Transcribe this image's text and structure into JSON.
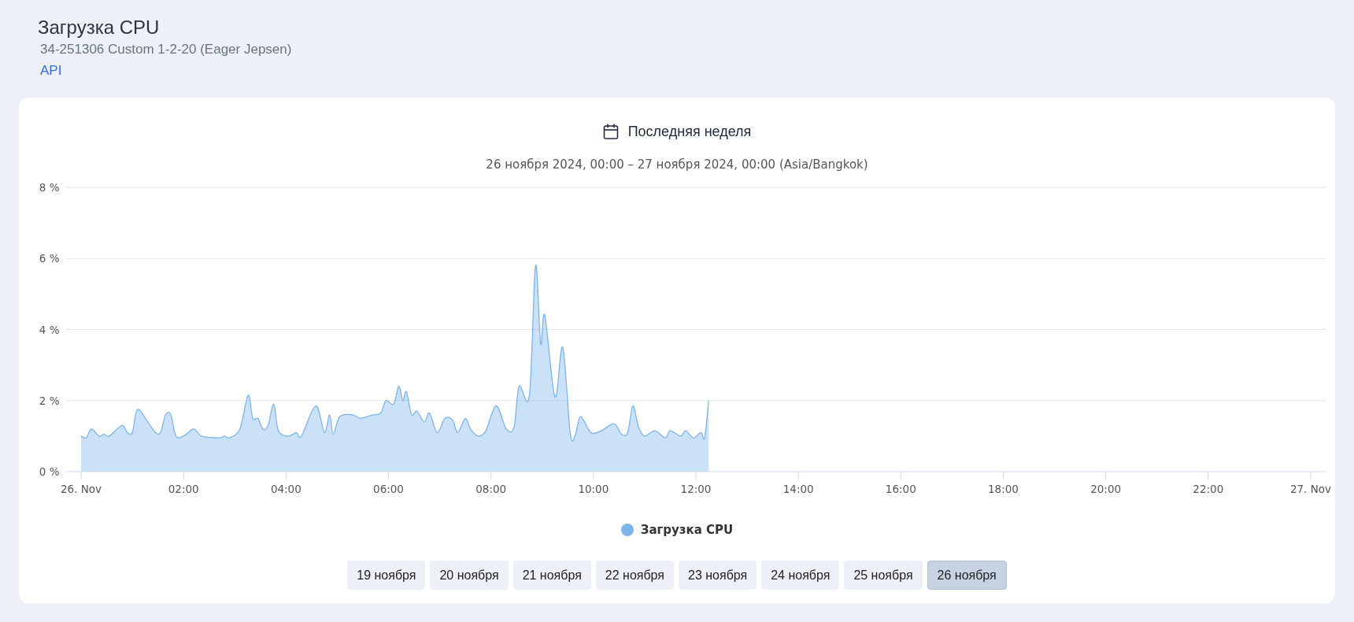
{
  "page": {
    "title": "Загрузка CPU",
    "subtitle": "34-251306 Custom 1-2-20 (Eager Jepsen)",
    "link": "API"
  },
  "card": {
    "period": "Последняя неделя",
    "range": "26 ноября 2024, 00:00 – 27 ноября 2024, 00:00 (Asia/Bangkok)",
    "chart_data": {
      "type": "area",
      "grid": true,
      "xlim": [
        -0.3,
        24.3
      ],
      "ylim": [
        0,
        8
      ],
      "xticks": [
        {
          "value": 0,
          "label": "26. Nov"
        },
        {
          "value": 2,
          "label": "02:00"
        },
        {
          "value": 4,
          "label": "04:00"
        },
        {
          "value": 6,
          "label": "06:00"
        },
        {
          "value": 8,
          "label": "08:00"
        },
        {
          "value": 10,
          "label": "10:00"
        },
        {
          "value": 12,
          "label": "12:00"
        },
        {
          "value": 14,
          "label": "14:00"
        },
        {
          "value": 16,
          "label": "16:00"
        },
        {
          "value": 18,
          "label": "18:00"
        },
        {
          "value": 20,
          "label": "20:00"
        },
        {
          "value": 22,
          "label": "22:00"
        },
        {
          "value": 24,
          "label": "27. Nov"
        }
      ],
      "yticks": [
        {
          "value": 0,
          "label": "0 %"
        },
        {
          "value": 2,
          "label": "2 %"
        },
        {
          "value": 4,
          "label": "4 %"
        },
        {
          "value": 6,
          "label": "6 %"
        },
        {
          "value": 8,
          "label": "8 %"
        }
      ],
      "x": [
        0,
        0.1,
        0.2,
        0.35,
        0.45,
        0.55,
        0.8,
        0.9,
        1.0,
        1.1,
        1.3,
        1.45,
        1.55,
        1.65,
        1.75,
        1.85,
        2.0,
        2.2,
        2.35,
        2.7,
        2.8,
        2.9,
        3.1,
        3.26,
        3.35,
        3.45,
        3.55,
        3.65,
        3.76,
        3.85,
        4.05,
        4.2,
        4.3,
        4.58,
        4.75,
        4.85,
        4.92,
        5.05,
        5.3,
        5.45,
        5.7,
        5.85,
        5.95,
        6.1,
        6.2,
        6.28,
        6.35,
        6.45,
        6.55,
        6.7,
        6.8,
        6.95,
        7.1,
        7.25,
        7.35,
        7.5,
        7.6,
        7.75,
        7.9,
        8.1,
        8.3,
        8.45,
        8.55,
        8.75,
        8.87,
        8.97,
        9.05,
        9.25,
        9.4,
        9.55,
        9.65,
        9.75,
        9.95,
        10.15,
        10.4,
        10.55,
        10.67,
        10.77,
        10.88,
        11.0,
        11.2,
        11.4,
        11.5,
        11.7,
        11.8,
        11.95,
        12.1,
        12.17,
        12.25
      ],
      "series": [
        {
          "name": "Загрузка CPU",
          "color": "#7cb5ec",
          "values": [
            1.0,
            0.95,
            1.2,
            1.0,
            1.05,
            1.0,
            1.3,
            1.1,
            1.1,
            1.75,
            1.4,
            1.1,
            1.1,
            1.6,
            1.6,
            1.0,
            1.0,
            1.2,
            1.0,
            0.95,
            1.0,
            0.95,
            1.2,
            2.15,
            1.5,
            1.5,
            1.2,
            1.3,
            1.9,
            1.15,
            1.0,
            1.1,
            1.0,
            1.85,
            1.1,
            1.6,
            1.05,
            1.55,
            1.6,
            1.5,
            1.6,
            1.65,
            2.0,
            1.9,
            2.4,
            2.0,
            2.25,
            1.6,
            1.7,
            1.4,
            1.65,
            1.1,
            1.5,
            1.45,
            1.1,
            1.5,
            1.2,
            1.0,
            1.15,
            1.85,
            1.2,
            1.25,
            2.4,
            2.15,
            5.8,
            3.6,
            4.4,
            2.1,
            3.5,
            1.05,
            1.05,
            1.55,
            1.1,
            1.15,
            1.35,
            1.05,
            1.1,
            1.85,
            1.25,
            1.0,
            1.15,
            0.95,
            1.15,
            1.0,
            1.15,
            0.95,
            1.1,
            0.95,
            2.0
          ]
        }
      ]
    },
    "days": [
      {
        "label": "19 ноября",
        "selected": false
      },
      {
        "label": "20 ноября",
        "selected": false
      },
      {
        "label": "21 ноября",
        "selected": false
      },
      {
        "label": "22 ноября",
        "selected": false
      },
      {
        "label": "23 ноября",
        "selected": false
      },
      {
        "label": "24 ноября",
        "selected": false
      },
      {
        "label": "25 ноября",
        "selected": false
      },
      {
        "label": "26 ноября",
        "selected": true
      }
    ]
  }
}
